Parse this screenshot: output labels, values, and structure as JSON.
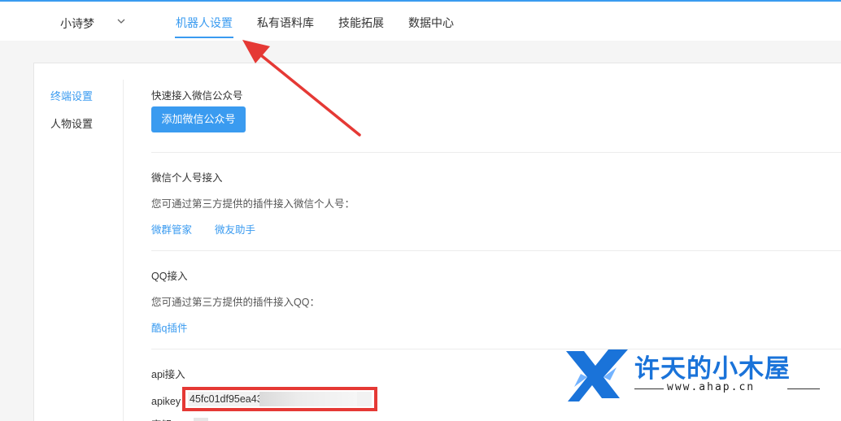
{
  "header": {
    "user_name": "小诗梦",
    "tabs": [
      {
        "label": "机器人设置",
        "active": true
      },
      {
        "label": "私有语料库",
        "active": false
      },
      {
        "label": "技能拓展",
        "active": false
      },
      {
        "label": "数据中心",
        "active": false
      }
    ]
  },
  "sidebar": {
    "items": [
      {
        "label": "终端设置",
        "active": true
      },
      {
        "label": "人物设置",
        "active": false
      }
    ]
  },
  "sections": {
    "wechat_official": {
      "title": "快速接入微信公众号",
      "button": "添加微信公众号"
    },
    "wechat_personal": {
      "title": "微信个人号接入",
      "desc": "您可通过第三方提供的插件接入微信个人号：",
      "links": [
        "微群管家",
        "微友助手"
      ]
    },
    "qq": {
      "title": "QQ接入",
      "desc": "您可通过第三方提供的插件接入QQ：",
      "links": [
        "酷q插件"
      ]
    },
    "api": {
      "title": "api接入",
      "apikey_label": "apikey：",
      "apikey_value": "45fc01df95ea43",
      "next_label": "密钥"
    }
  },
  "watermark": {
    "title": "许天的小木屋",
    "url": "www.ahap.cn"
  },
  "colors": {
    "accent": "#3a9bf0",
    "annotation": "#e53935",
    "watermark": "#1a73d9"
  }
}
